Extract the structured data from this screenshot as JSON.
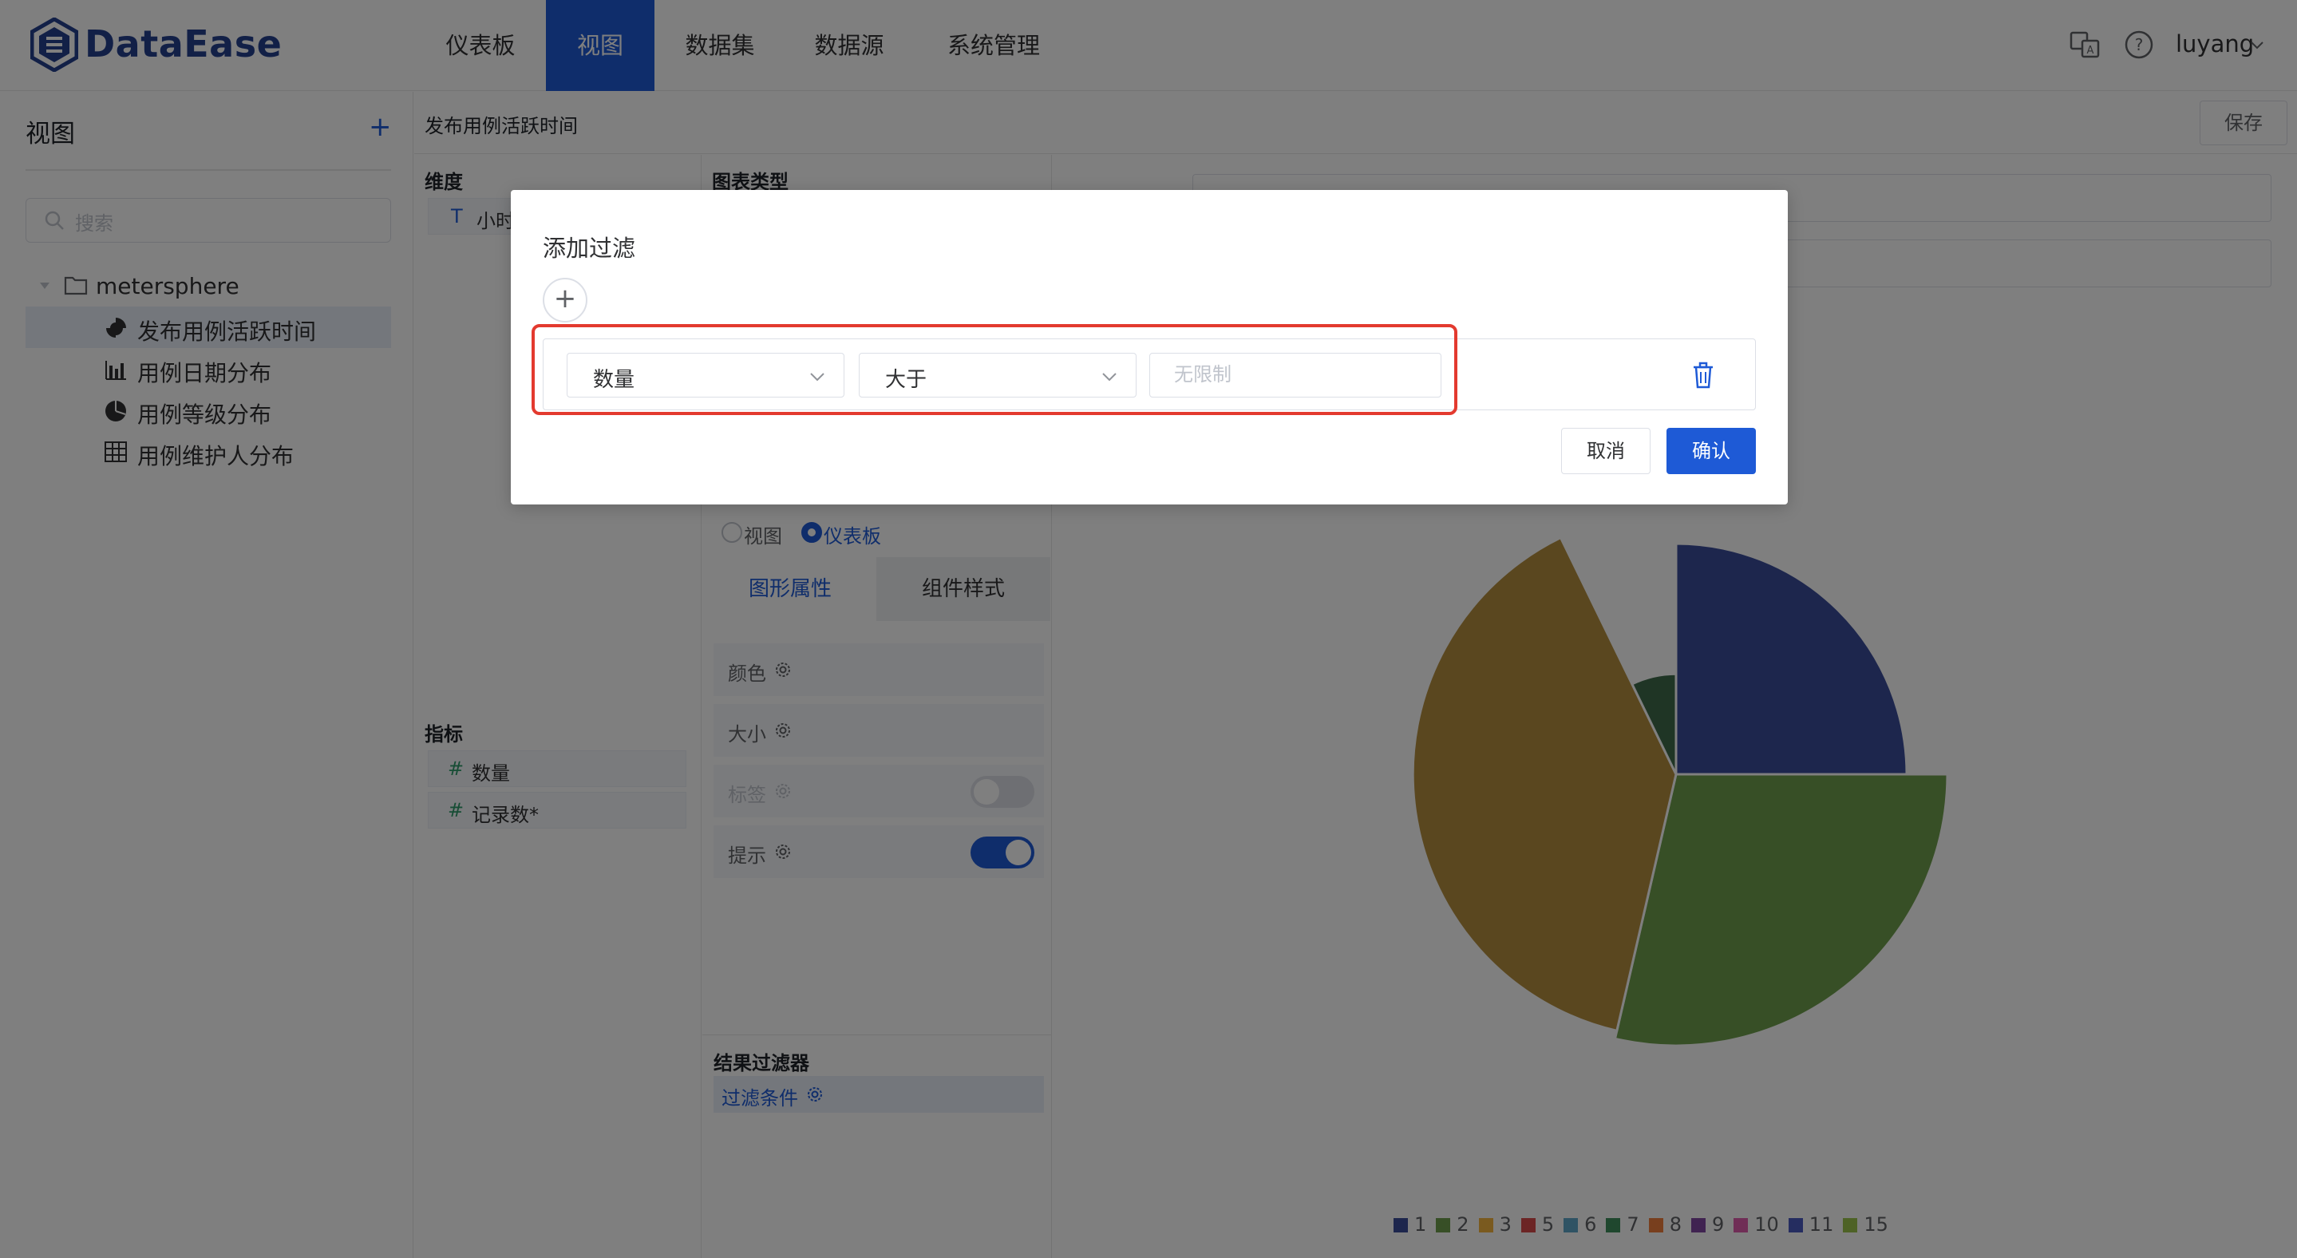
{
  "app": {
    "name": "DataEase"
  },
  "nav": {
    "items": [
      {
        "label": "仪表板",
        "active": false
      },
      {
        "label": "视图",
        "active": true
      },
      {
        "label": "数据集",
        "active": false
      },
      {
        "label": "数据源",
        "active": false
      },
      {
        "label": "系统管理",
        "active": false
      }
    ],
    "user": "luyang"
  },
  "sidebar": {
    "title": "视图",
    "add_icon": "plus-icon",
    "search_placeholder": "搜索",
    "folder": "metersphere",
    "items": [
      {
        "label": "发布用例活跃时间",
        "icon": "rose-chart-icon",
        "selected": true
      },
      {
        "label": "用例日期分布",
        "icon": "bar-chart-icon",
        "selected": false
      },
      {
        "label": "用例等级分布",
        "icon": "pie-chart-icon",
        "selected": false
      },
      {
        "label": "用例维护人分布",
        "icon": "table-icon",
        "selected": false
      }
    ]
  },
  "editor": {
    "chart_name": "发布用例活跃时间",
    "save_label": "保存",
    "dimension_label": "维度",
    "dimension_field": "小时",
    "chart_type_label": "图表类型",
    "measure_label": "指标",
    "measures": [
      "数量",
      "记录数*"
    ],
    "scope_options": {
      "view": "视图",
      "dashboard": "仪表板",
      "selected": "仪表板"
    },
    "tabs": {
      "shape": "图形属性",
      "style": "组件样式"
    },
    "props": [
      {
        "label": "颜色",
        "toggle": null
      },
      {
        "label": "大小",
        "toggle": null
      },
      {
        "label": "标签",
        "toggle": "off",
        "disabled": true
      },
      {
        "label": "提示",
        "toggle": "on"
      }
    ],
    "result_filter_label": "结果过滤器",
    "filter_condition_label": "过滤条件"
  },
  "dialog": {
    "title": "添加过滤",
    "field": "数量",
    "operator": "大于",
    "value_placeholder": "无限制",
    "cancel_label": "取消",
    "confirm_label": "确认"
  },
  "colors": {
    "accent": "#1e5ad6",
    "highlight_border": "#e33a2f"
  },
  "chart_data": {
    "type": "pie",
    "subtype": "rose",
    "categories": [
      "1",
      "2",
      "3",
      "5",
      "6",
      "7",
      "8",
      "9",
      "10",
      "11",
      "15"
    ],
    "legend_colors": [
      "#3b4d9b",
      "#6f9e4c",
      "#f4b53f",
      "#d84b4b",
      "#5ea6c8",
      "#3e8f5d",
      "#f07f3c",
      "#8046a3",
      "#e05cad",
      "#4a5ac0",
      "#9dc44d"
    ],
    "visible_slices": [
      {
        "category": "11",
        "color": "#3b4d9b",
        "relative_radius": 0.85
      },
      {
        "category": "15",
        "color": "#6f9e4c",
        "relative_radius": 1.0
      },
      {
        "category": "3",
        "color": "#b58e3f",
        "relative_radius": 0.97
      },
      {
        "category": "7",
        "color": "#3e6b4a",
        "relative_radius": 0.37
      }
    ],
    "legend_position": "bottom"
  }
}
